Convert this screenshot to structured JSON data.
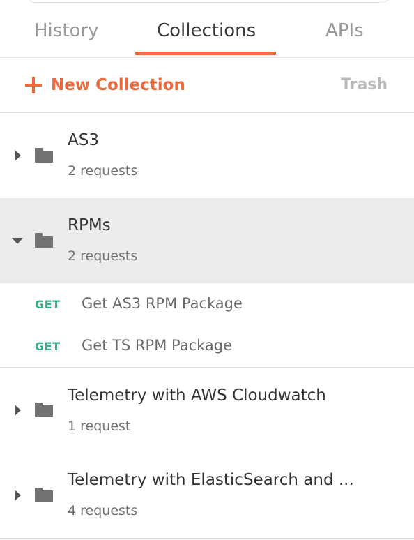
{
  "tabs": [
    {
      "label": "History"
    },
    {
      "label": "Collections"
    },
    {
      "label": "APIs"
    }
  ],
  "active_tab": "Collections",
  "toolbar": {
    "new_collection_label": "New Collection",
    "trash_label": "Trash"
  },
  "colors": {
    "accent": "#ef6c40",
    "get_method": "#30b07f",
    "selected_row_bg": "#ececec"
  },
  "collections": [
    {
      "name": "AS3",
      "count": "2 requests",
      "expanded": false
    },
    {
      "name": "RPMs",
      "count": "2 requests",
      "expanded": true,
      "requests": [
        {
          "method": "GET",
          "name": "Get AS3 RPM Package"
        },
        {
          "method": "GET",
          "name": "Get TS RPM Package"
        }
      ]
    },
    {
      "name": "Telemetry with AWS Cloudwatch",
      "count": "1 request",
      "expanded": false
    },
    {
      "name": "Telemetry with ElasticSearch and ...",
      "count": "4 requests",
      "expanded": false
    }
  ]
}
